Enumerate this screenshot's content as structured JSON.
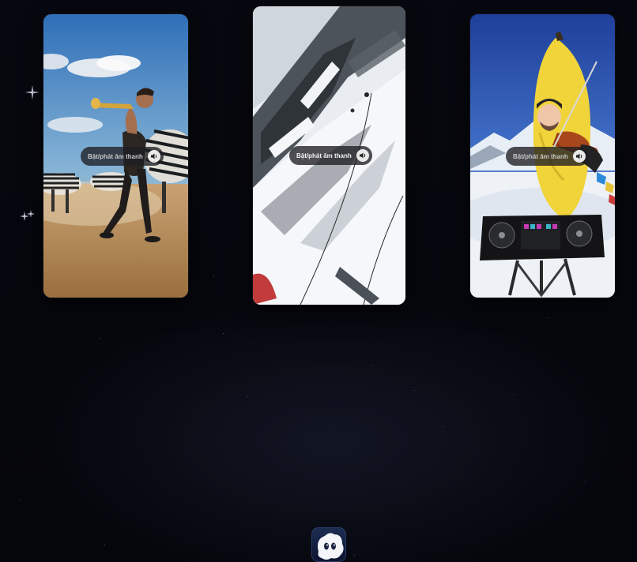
{
  "reels": [
    {
      "id": "trumpet-zebra",
      "sound_label": "Bật/phát âm thanh",
      "icon": "speaker-icon"
    },
    {
      "id": "mountain-climb",
      "sound_label": "Bật/phát âm thanh",
      "icon": "speaker-icon"
    },
    {
      "id": "banana-violin",
      "sound_label": "Bật/phát âm thanh",
      "icon": "speaker-icon"
    }
  ],
  "mascot": {
    "icon": "ghost-mascot-icon"
  },
  "colors": {
    "background": "#05060d",
    "pill": "#1e1e22",
    "pill_text": "#f2f2f2"
  }
}
